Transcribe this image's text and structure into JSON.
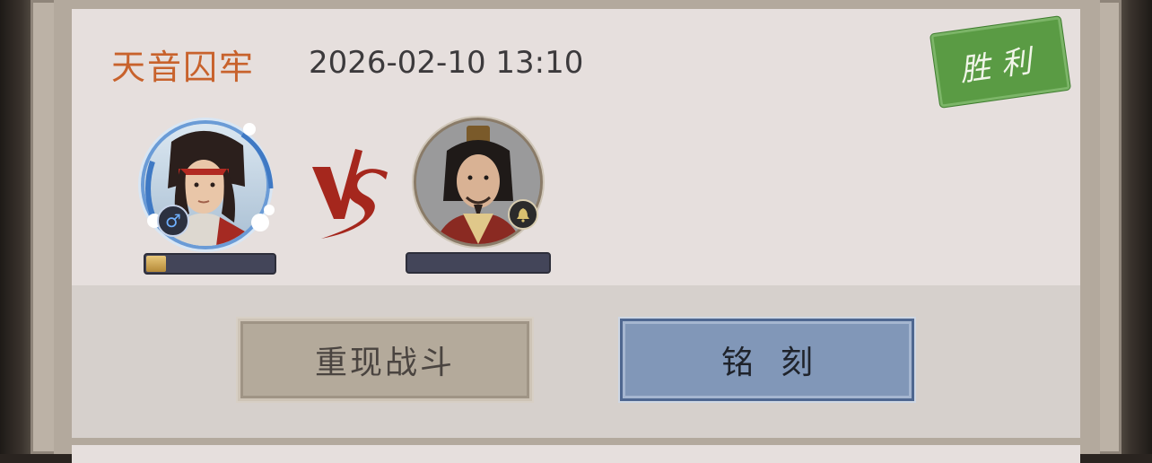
{
  "battle": {
    "mode": "天音囚牢",
    "time": "2026-02-10 13:10",
    "result": "胜利"
  },
  "player": {
    "gender_symbol": "♂",
    "progress": 0.15
  },
  "opponent": {
    "rank_icon": "bell-icon",
    "progress": 0
  },
  "vs_text": "VS",
  "buttons": {
    "replay": "重现战斗",
    "engrave": "铭刻"
  },
  "colors": {
    "mode_title": "#c8622c",
    "stamp_green": "#5a9b44",
    "replay_button": "#b4aa9b",
    "engrave_button": "#8197b8",
    "bar_track": "#434559"
  }
}
